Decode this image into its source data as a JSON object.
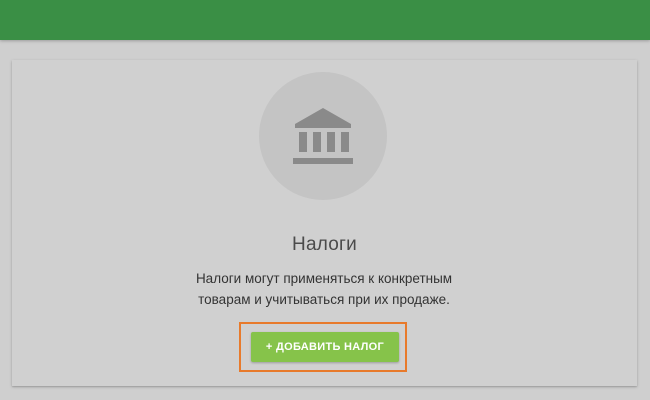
{
  "empty_state": {
    "icon": "bank-icon",
    "title": "Налоги",
    "description_line1": "Налоги могут применяться к конкретным",
    "description_line2": "товарам и учитываться при их продаже.",
    "add_button_label": "+ ДОБАВИТЬ НАЛОГ"
  },
  "colors": {
    "topbar": "#3a8f45",
    "card_background": "#d0d0d0",
    "button": "#86c34a",
    "highlight": "#e87a2b"
  }
}
